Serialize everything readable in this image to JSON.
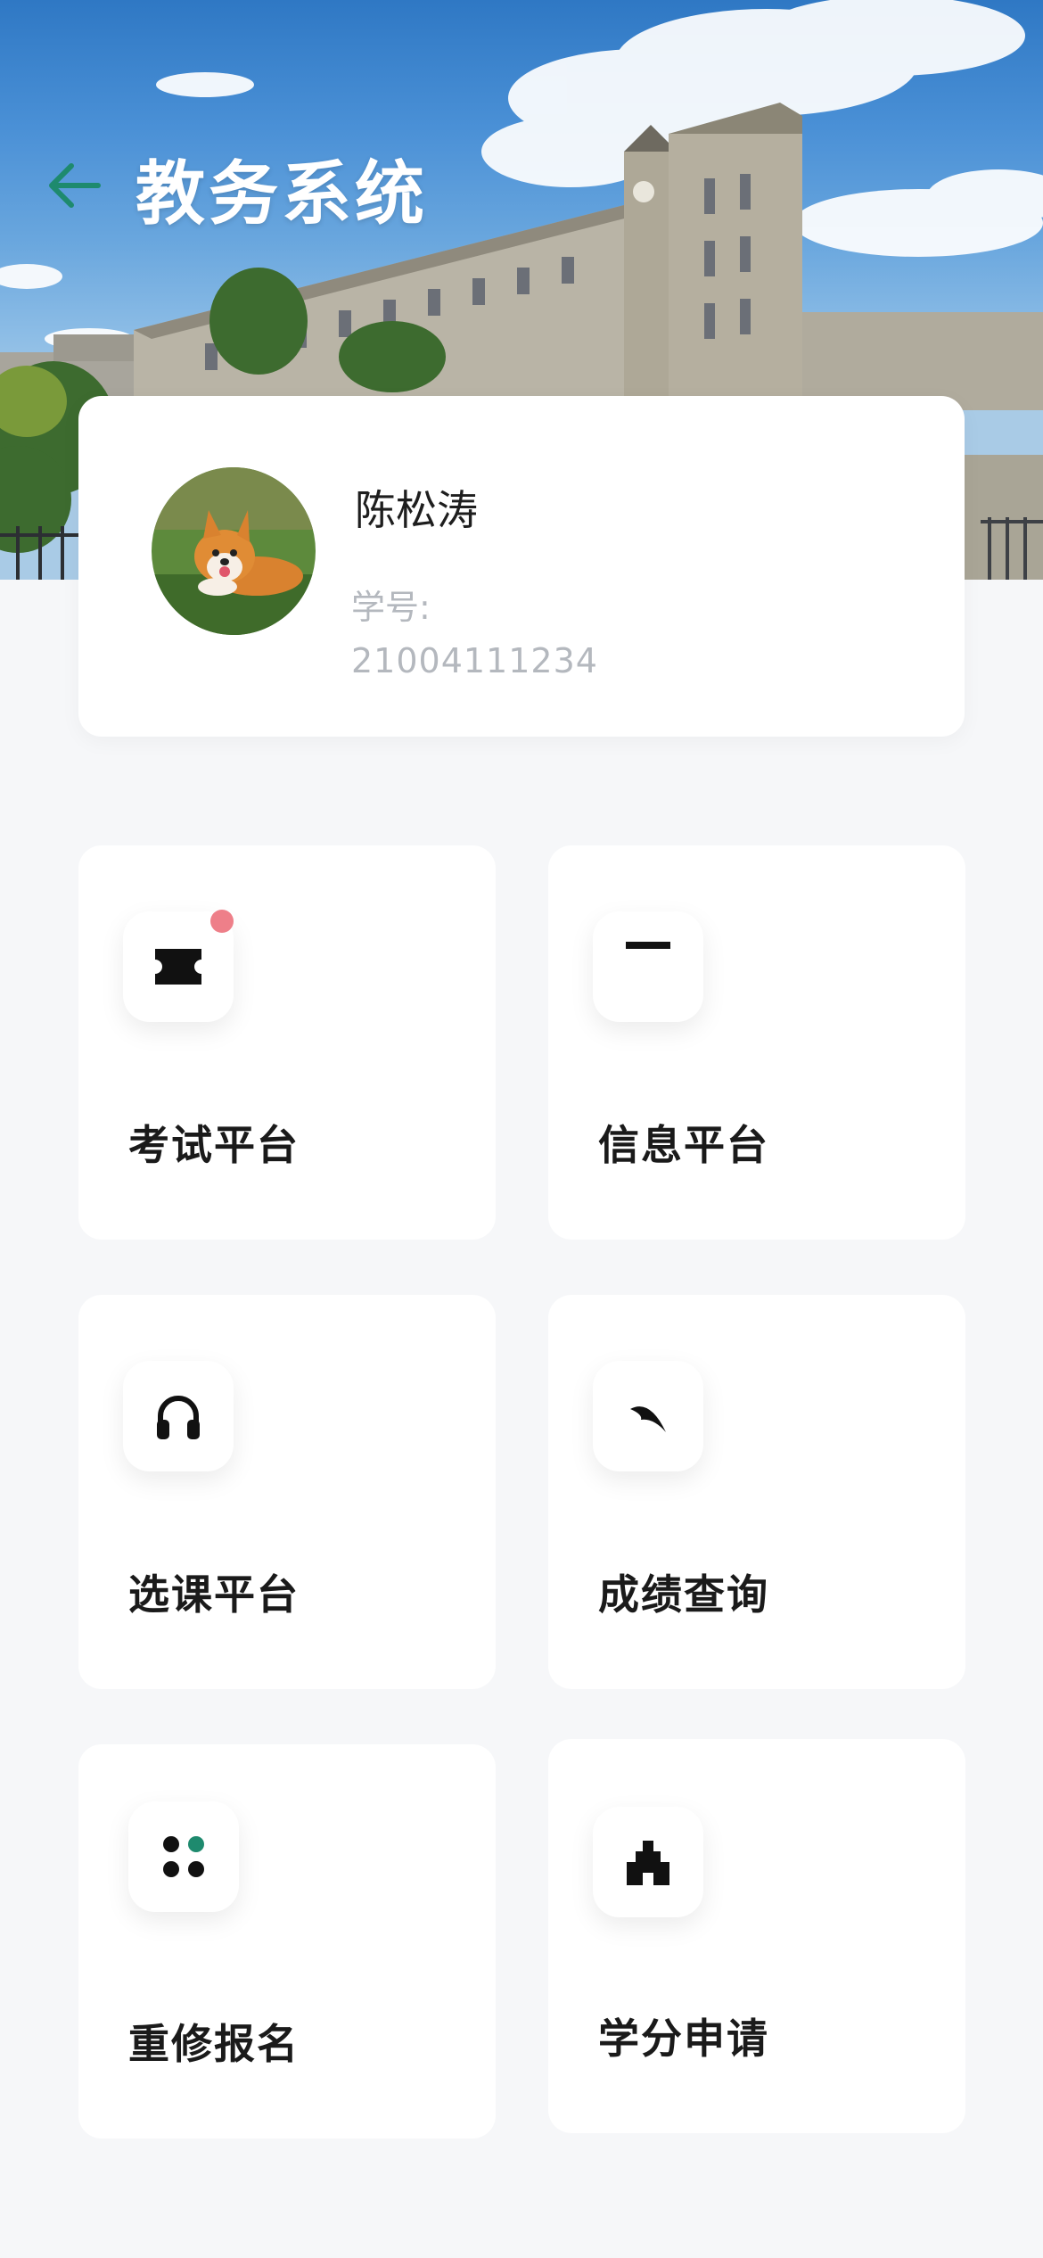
{
  "header": {
    "title": "教务系统",
    "back_icon": "arrow-left-icon",
    "accent_color": "#1e8a6e"
  },
  "profile": {
    "name": "陈松涛",
    "id_label": "学号:",
    "id_value": "21004111234",
    "avatar": "corgi-dog-photo"
  },
  "tiles": [
    {
      "label": "考试平台",
      "icon": "ticket-icon",
      "has_notification": true,
      "notification_color": "#ee7f89"
    },
    {
      "label": "信息平台",
      "icon": "minus-icon",
      "has_notification": false
    },
    {
      "label": "选课平台",
      "icon": "headphones-icon",
      "has_notification": false
    },
    {
      "label": "成绩查询",
      "icon": "leaf-icon",
      "has_notification": false
    },
    {
      "label": "重修报名",
      "icon": "four-dots-icon",
      "has_notification": false
    },
    {
      "label": "学分申请",
      "icon": "building-icon",
      "has_notification": false
    }
  ]
}
